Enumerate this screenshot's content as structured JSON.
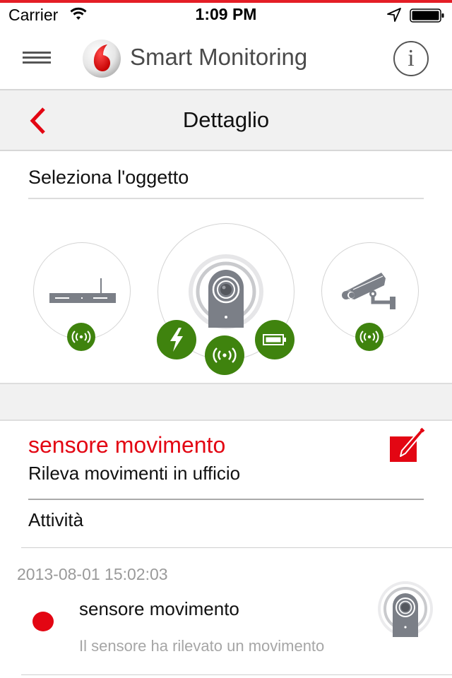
{
  "status_bar": {
    "carrier": "Carrier",
    "time": "1:09 PM",
    "icons": [
      "wifi-icon",
      "location-arrow-icon",
      "battery-icon"
    ]
  },
  "header": {
    "title": "Smart Monitoring",
    "menu_icon": "hamburger-menu-icon",
    "logo_icon": "vodafone-logo",
    "info_icon": "info-icon",
    "info_glyph": "i"
  },
  "sub_nav": {
    "title": "Dettaglio",
    "back_icon": "chevron-left-icon"
  },
  "selector": {
    "label": "Seleziona l'oggetto",
    "devices": [
      {
        "name": "router",
        "icon": "router-icon",
        "badges": [
          "wireless-signal-icon"
        ],
        "selected": false
      },
      {
        "name": "motion-sensor",
        "icon": "motion-sensor-icon",
        "badges": [
          "power-lightning-icon",
          "wireless-signal-icon",
          "battery-icon"
        ],
        "selected": true
      },
      {
        "name": "camera",
        "icon": "security-camera-icon",
        "badges": [
          "wireless-signal-icon"
        ],
        "selected": false
      }
    ]
  },
  "detail": {
    "name": "sensore movimento",
    "description": "Rileva movimenti in ufficio",
    "edit_icon": "edit-pencil-icon",
    "activity_heading": "Attività"
  },
  "activity": [
    {
      "timestamp": "2013-08-01 15:02:03",
      "title": "sensore movimento",
      "message": "Il sensore ha rilevato un movimento",
      "status_icon": "red-dot-icon",
      "thumbnail_icon": "motion-sensor-icon"
    }
  ],
  "colors": {
    "accent_red": "#e30613",
    "status_green": "#3f830e",
    "device_grey": "#7b7f87",
    "band_grey": "#f1f1f1"
  }
}
